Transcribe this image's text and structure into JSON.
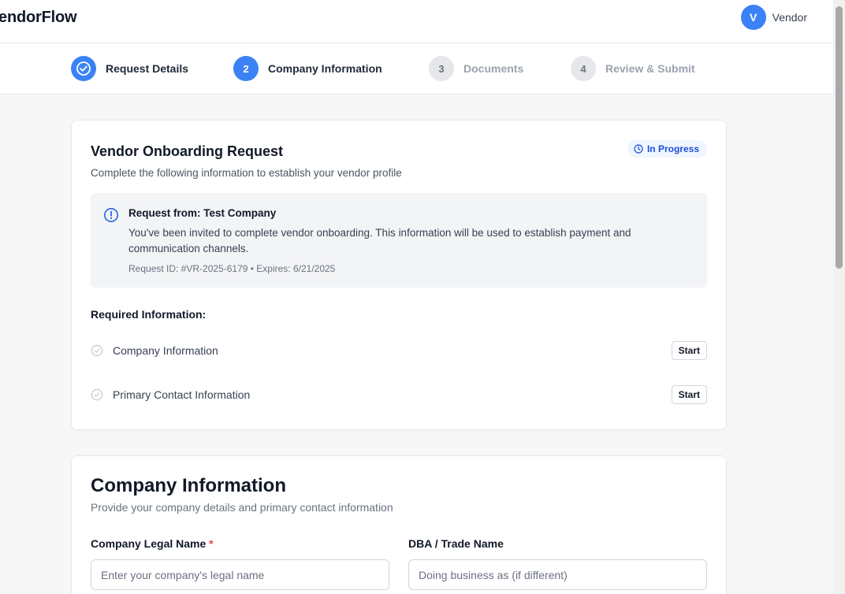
{
  "app": {
    "brand": "VendorFlow"
  },
  "user": {
    "avatar_initial": "V",
    "name": "Vendor",
    "avatar_color": "#3b82f6"
  },
  "stepper": {
    "steps": [
      {
        "number": "",
        "label": "Request Details",
        "state": "done"
      },
      {
        "number": "2",
        "label": "Company Information",
        "state": "active"
      },
      {
        "number": "3",
        "label": "Documents",
        "state": "pending"
      },
      {
        "number": "4",
        "label": "Review & Submit",
        "state": "pending"
      }
    ]
  },
  "request_card": {
    "title": "Vendor Onboarding Request",
    "subtitle": "Complete the following information to establish your vendor profile",
    "status": "In Progress",
    "notice": {
      "title": "Request from: Test Company",
      "body": "You've been invited to complete vendor onboarding. This information will be used to establish payment and communication channels.",
      "meta": "Request ID: #VR-2025-6179 • Expires: 6/21/2025"
    },
    "required_heading": "Required Information:",
    "items": [
      {
        "label": "Company Information",
        "action": "Start"
      },
      {
        "label": "Primary Contact Information",
        "action": "Start"
      }
    ]
  },
  "company_form": {
    "title": "Company Information",
    "subtitle": "Provide your company details and primary contact information",
    "fields": [
      {
        "label": "Company Legal Name",
        "required_mark": "*",
        "placeholder": "Enter your company's legal name",
        "value": ""
      },
      {
        "label": "DBA / Trade Name",
        "placeholder": "Doing business as (if different)",
        "value": ""
      }
    ]
  },
  "colors": {
    "accent": "#3b82f6",
    "badge_text": "#1d4ed8",
    "badge_bg": "#eff6ff",
    "required": "#ef4444"
  }
}
